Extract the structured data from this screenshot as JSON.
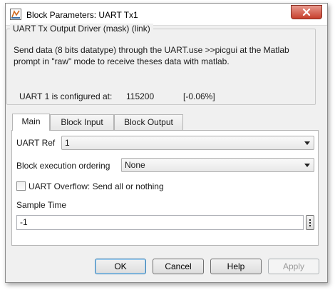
{
  "window": {
    "title": "Block Parameters: UART Tx1"
  },
  "mask": {
    "group_title": "UART Tx Output Driver (mask) (link)",
    "description": "Send data (8 bits datatype) through the UART.use >>picgui at the Matlab prompt in \"raw\" mode to receive theses data with matlab.",
    "uart_label": "UART 1 is configured at:",
    "baud_value": "115200",
    "error_value": "[-0.06%]"
  },
  "tabs": [
    {
      "label": "Main",
      "active": true
    },
    {
      "label": "Block Input",
      "active": false
    },
    {
      "label": "Block Output",
      "active": false
    }
  ],
  "params": {
    "uart_ref_label": "UART Ref",
    "uart_ref_value": "1",
    "exec_order_label": "Block execution ordering",
    "exec_order_value": "None",
    "overflow_label": "UART Overflow: Send all or nothing",
    "overflow_checked": false,
    "sample_time_label": "Sample Time",
    "sample_time_value": "-1"
  },
  "buttons": {
    "ok": "OK",
    "cancel": "Cancel",
    "help": "Help",
    "apply": "Apply"
  },
  "icons": {
    "app": "simulink-block-icon",
    "close": "close-icon",
    "dropdown": "chevron-down-icon",
    "more": "vertical-ellipsis-icon"
  },
  "colors": {
    "close_button": "#c7402d",
    "dialog_background": "#f0f0f0",
    "default_button_border": "#3c7fb1"
  }
}
